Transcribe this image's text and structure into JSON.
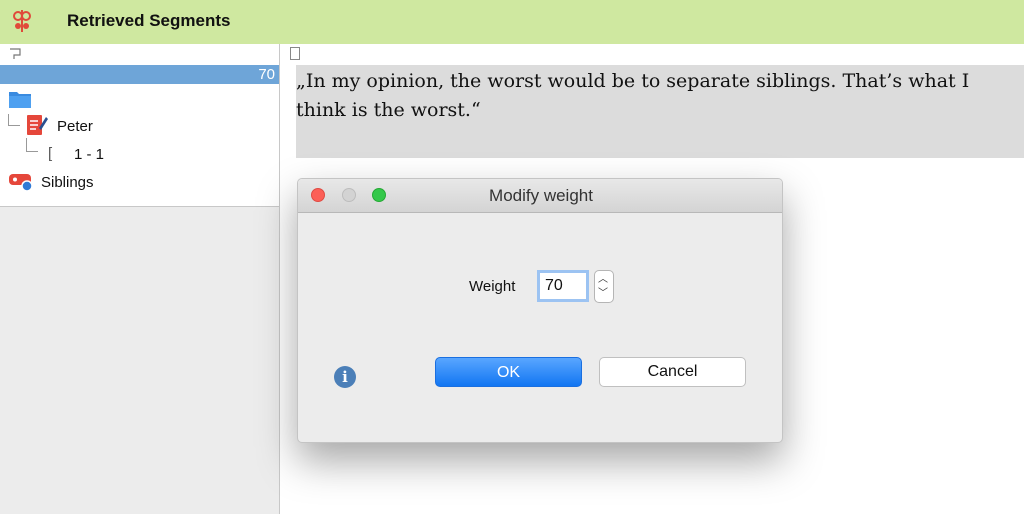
{
  "window": {
    "title": "Retrieved Segments"
  },
  "tree": {
    "selected_value": "70",
    "document": "Peter",
    "segment": "1 - 1",
    "code": "Siblings"
  },
  "segment_text": "„In my opinion, the worst would be to separate siblings. That’s what I think is the worst.“",
  "dialog": {
    "title": "Modify weight",
    "weight_label": "Weight",
    "weight_value": "70",
    "ok_label": "OK",
    "cancel_label": "Cancel"
  },
  "icons": {
    "app": "retrieved-segments-icon",
    "folder": "folder-icon",
    "document": "document-icon",
    "code": "code-icon",
    "info": "info-icon"
  },
  "colors": {
    "titlebar_bg": "#cfe8a0",
    "selection": "#6ea5d8",
    "ok_button": "#1276f2"
  }
}
